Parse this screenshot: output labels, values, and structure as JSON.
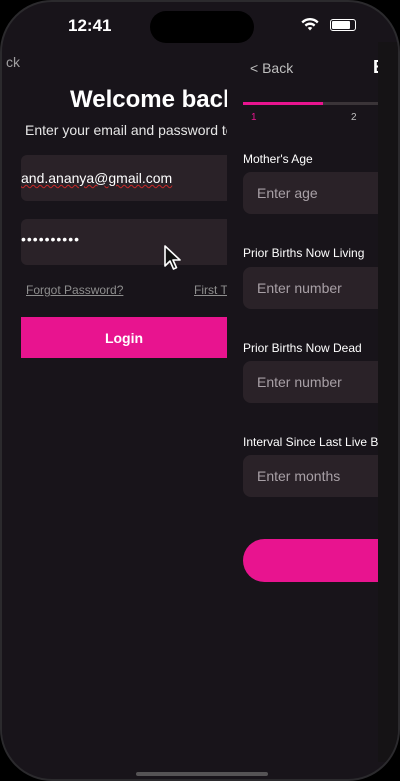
{
  "status_bar": {
    "time": "12:41"
  },
  "login": {
    "back_label": "ck",
    "title": "Welcome back",
    "subtitle": "Enter your email and password to",
    "email_value": "and.ananya@gmail.com",
    "password_value": "••••••••••",
    "forgot_password": "Forgot Password?",
    "first_time": "First T",
    "login_button": "Login"
  },
  "form": {
    "back_label": "< Back",
    "title": "B",
    "progress": 0.5,
    "steps": [
      "1",
      "2"
    ],
    "active_step": 1,
    "fields": [
      {
        "label": "Mother's Age",
        "placeholder": "Enter age"
      },
      {
        "label": "Prior Births Now Living",
        "placeholder": "Enter number"
      },
      {
        "label": "Prior Births Now Dead",
        "placeholder": "Enter number"
      },
      {
        "label": "Interval Since Last Live B",
        "placeholder": "Enter months"
      }
    ]
  },
  "colors": {
    "accent": "#e8148f",
    "background": "#18141a",
    "input_bg": "#2a2228"
  }
}
